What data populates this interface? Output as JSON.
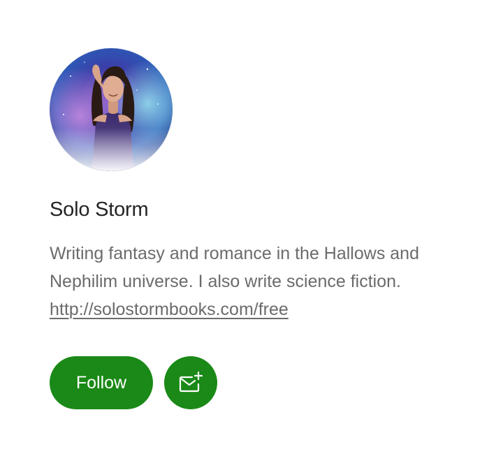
{
  "profile": {
    "name": "Solo Storm",
    "bio_line1": "Writing fantasy and romance in the Hallows and",
    "bio_line2": "Nephilim universe. I also write science fiction.",
    "link_text": "http://solostormbooks.com/free",
    "avatar_icon": "author-photo-avatar"
  },
  "actions": {
    "follow_label": "Follow",
    "subscribe_icon": "mail-plus-icon"
  },
  "colors": {
    "accent": "#1a8917",
    "name_text": "#242424",
    "bio_text": "#6b6b6b"
  }
}
